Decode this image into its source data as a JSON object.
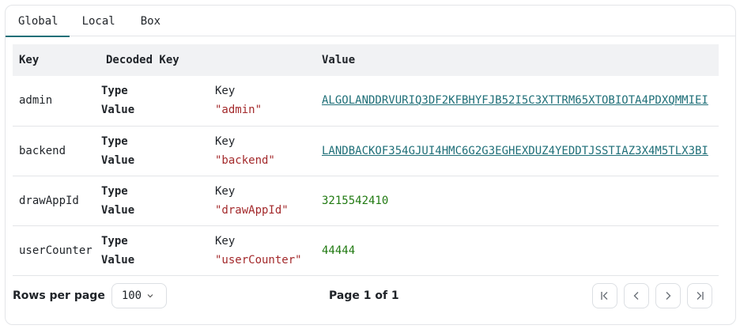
{
  "tabs": [
    {
      "label": "Global",
      "active": true
    },
    {
      "label": "Local",
      "active": false
    },
    {
      "label": "Box",
      "active": false
    }
  ],
  "table": {
    "headers": [
      "Key",
      "Decoded Key",
      "Value"
    ],
    "decoded_labels": {
      "type": "Type",
      "value": "Value"
    },
    "rows": [
      {
        "key": "admin",
        "type": "Key",
        "decoded": "\"admin\"",
        "value": "ALGOLANDDRVURIQ3DF2KFBHYFJB52I5C3XTTRM65XTOBIOTA4PDXQMMIEI",
        "value_kind": "address"
      },
      {
        "key": "backend",
        "type": "Key",
        "decoded": "\"backend\"",
        "value": "LANDBACKOF354GJUI4HMC6G2G3EGHEXDUZ4YEDDTJSSTIAZ3X4M5TLX3BI",
        "value_kind": "address"
      },
      {
        "key": "drawAppId",
        "type": "Key",
        "decoded": "\"drawAppId\"",
        "value": "3215542410",
        "value_kind": "number"
      },
      {
        "key": "userCounter",
        "type": "Key",
        "decoded": "\"userCounter\"",
        "value": "44444",
        "value_kind": "number"
      }
    ]
  },
  "footer": {
    "rows_per_page_label": "Rows per page",
    "rows_per_page_value": "100",
    "page_info": "Page 1 of 1"
  },
  "colors": {
    "accent": "#1f6f78",
    "string": "#a3292b",
    "number": "#217a12",
    "header_bg": "#f1f2f4",
    "border": "#e3e5e8"
  },
  "icons": [
    "chevron-down-icon",
    "first-page-icon",
    "previous-page-icon",
    "next-page-icon",
    "last-page-icon"
  ]
}
